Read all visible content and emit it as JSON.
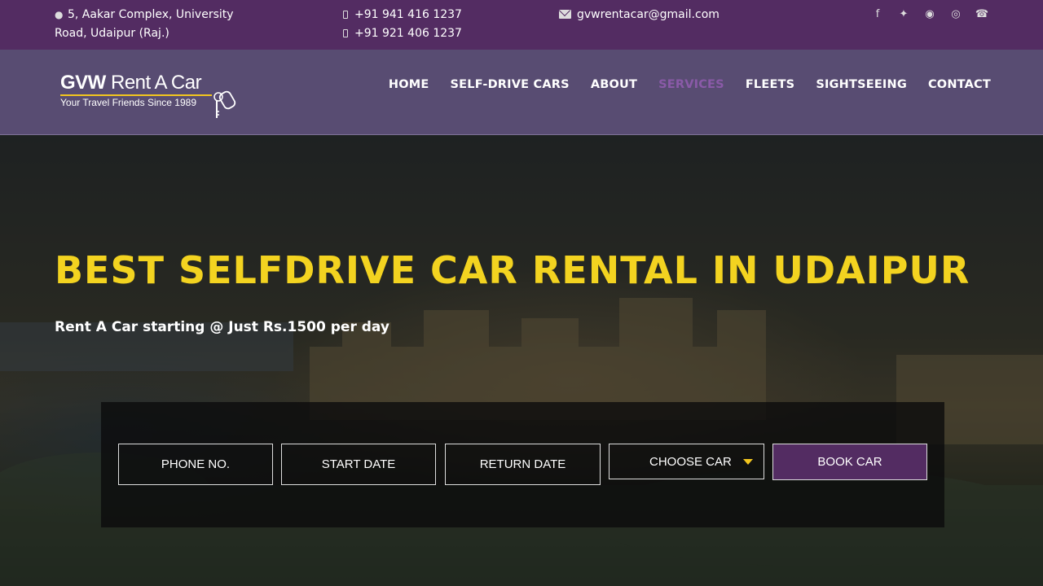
{
  "topbar": {
    "address_line1": "5, Aakar Complex, University",
    "address_line2": "Road, Udaipur (Raj.)",
    "phone1": "+91 941 416 1237",
    "phone2": "+91 921 406 1237",
    "email": "gvwrentacar@gmail.com",
    "social": [
      "facebook-icon",
      "twitter-icon",
      "instagram-icon",
      "tripadvisor-icon",
      "whatsapp-icon"
    ]
  },
  "logo": {
    "brand_bold": "GVW",
    "brand_rest": " Rent A Car",
    "tagline": "Your Travel Friends Since 1989"
  },
  "nav": {
    "items": [
      {
        "label": "HOME"
      },
      {
        "label": "SELF-DRIVE CARS"
      },
      {
        "label": "ABOUT"
      },
      {
        "label": "SERVICES",
        "active": true
      },
      {
        "label": "FLEETS"
      },
      {
        "label": "SIGHTSEEING"
      },
      {
        "label": "CONTACT"
      }
    ]
  },
  "hero": {
    "headline": "BEST SELFDRIVE CAR RENTAL IN UDAIPUR",
    "subheading": "Rent A Car starting @ Just Rs.1500 per day"
  },
  "booking": {
    "phone_placeholder": "PHONE NO.",
    "start_placeholder": "START DATE",
    "return_placeholder": "RETURN DATE",
    "car_select": "CHOOSE CAR",
    "book_label": "BOOK CAR"
  },
  "colors": {
    "brand_purple": "#532c62",
    "headline_yellow": "#f3d320",
    "nav_active": "#8a5aa8"
  }
}
